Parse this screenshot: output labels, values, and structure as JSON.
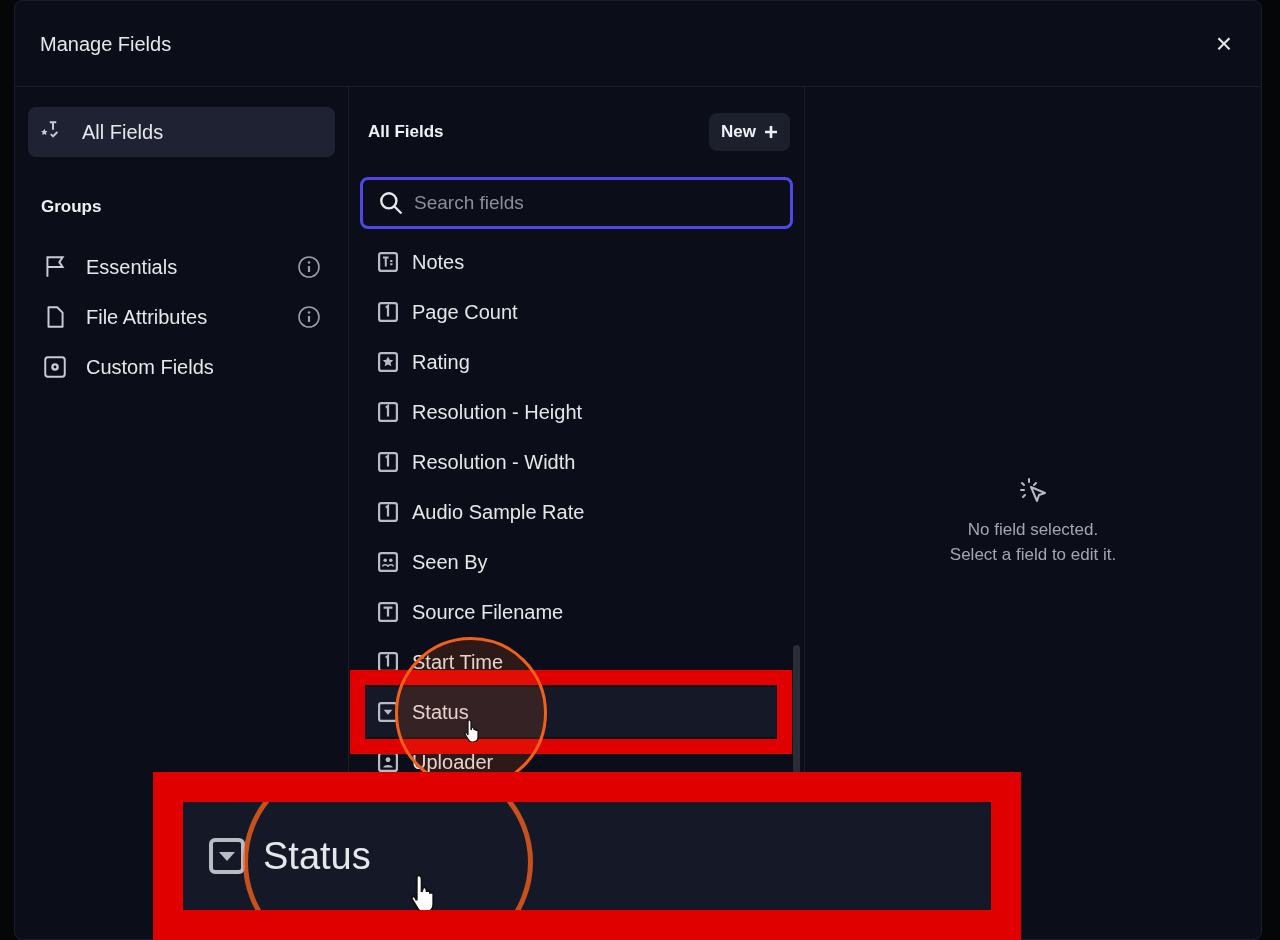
{
  "dialog": {
    "title": "Manage Fields",
    "close": "×"
  },
  "sidebar": {
    "items": [
      {
        "label": "All Fields",
        "kind": "all",
        "selected": true
      }
    ],
    "groups_heading": "Groups",
    "groups": [
      {
        "label": "Essentials",
        "kind": "flag",
        "info": true
      },
      {
        "label": "File Attributes",
        "kind": "file",
        "info": true
      },
      {
        "label": "Custom Fields",
        "kind": "gear",
        "info": false
      }
    ]
  },
  "fields": {
    "heading": "All Fields",
    "new_button": "New",
    "search": {
      "placeholder": "Search fields"
    },
    "items": [
      {
        "label": "Notes",
        "kind": "notes",
        "selected": false
      },
      {
        "label": "Page Count",
        "kind": "number",
        "selected": false
      },
      {
        "label": "Rating",
        "kind": "rating",
        "selected": false
      },
      {
        "label": "Resolution - Height",
        "kind": "number",
        "selected": false
      },
      {
        "label": "Resolution - Width",
        "kind": "number",
        "selected": false
      },
      {
        "label": "Audio Sample Rate",
        "kind": "number",
        "selected": false
      },
      {
        "label": "Seen By",
        "kind": "users",
        "selected": false
      },
      {
        "label": "Source Filename",
        "kind": "text",
        "selected": false
      },
      {
        "label": "Start Time",
        "kind": "number",
        "selected": false
      },
      {
        "label": "Status",
        "kind": "dropdown",
        "selected": true
      },
      {
        "label": "Uploader",
        "kind": "person",
        "selected": false
      }
    ]
  },
  "detail": {
    "empty_lines": [
      "No field selected.",
      "Select a field to edit it."
    ]
  },
  "callout": {
    "label": "Status",
    "kind": "dropdown"
  }
}
